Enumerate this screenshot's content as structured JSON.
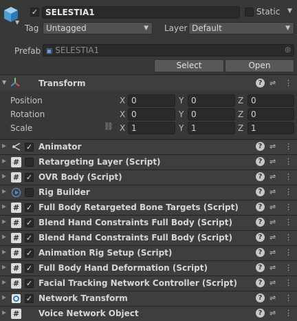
{
  "object": {
    "name": "SELESTIA1",
    "active": true,
    "static_label": "Static",
    "static_checked": false
  },
  "tag": {
    "label": "Tag",
    "value": "Untagged"
  },
  "layer": {
    "label": "Layer",
    "value": "Default"
  },
  "prefab": {
    "label": "Prefab",
    "value": "SELESTIA1",
    "select_label": "Select",
    "open_label": "Open"
  },
  "transform": {
    "title": "Transform",
    "position": {
      "label": "Position",
      "x": "0",
      "y": "0",
      "z": "0"
    },
    "rotation": {
      "label": "Rotation",
      "x": "0",
      "y": "0",
      "z": "0"
    },
    "scale": {
      "label": "Scale",
      "x": "1",
      "y": "1",
      "z": "1"
    },
    "axis": {
      "x": "X",
      "y": "Y",
      "z": "Z"
    }
  },
  "components": [
    {
      "name": "Animator",
      "enabled": true,
      "icon": "animator-icon"
    },
    {
      "name": "Retargeting Layer (Script)",
      "enabled": false,
      "icon": "script-icon"
    },
    {
      "name": "OVR Body (Script)",
      "enabled": true,
      "icon": "script-icon"
    },
    {
      "name": "Rig Builder",
      "enabled": false,
      "icon": "rig-builder-icon"
    },
    {
      "name": "Full Body Retargeted Bone Targets (Script)",
      "enabled": true,
      "icon": "script-icon"
    },
    {
      "name": "Blend Hand Constraints Full Body (Script)",
      "enabled": true,
      "icon": "script-icon"
    },
    {
      "name": "Blend Hand Constraints Full Body (Script)",
      "enabled": true,
      "icon": "script-icon"
    },
    {
      "name": "Animation Rig Setup (Script)",
      "enabled": true,
      "icon": "script-icon"
    },
    {
      "name": "Full Body Hand Deformation (Script)",
      "enabled": true,
      "icon": "script-icon"
    },
    {
      "name": "Facial Tracking Network Controller (Script)",
      "enabled": true,
      "icon": "script-icon"
    },
    {
      "name": "Network Transform",
      "enabled": true,
      "icon": "network-transform-icon"
    },
    {
      "name": "Voice Network Object",
      "enabled": null,
      "icon": "script-icon"
    }
  ],
  "colors": {
    "background": "#383838",
    "field": "#2a2a2a",
    "header": "#3e3e3e",
    "accent": "#4a90d9"
  }
}
